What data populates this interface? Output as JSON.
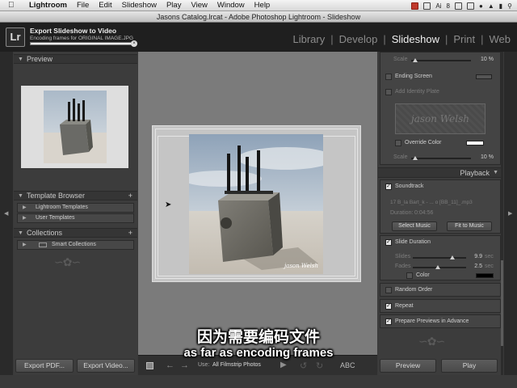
{
  "menubar": {
    "items": [
      "Lightroom",
      "File",
      "Edit",
      "Slideshow",
      "Play",
      "View",
      "Window",
      "Help"
    ],
    "tray": {
      "ai": "Ai",
      "ai_count": "8"
    }
  },
  "window": {
    "title": "Jasons Catalog.lrcat - Adobe Photoshop Lightroom - Slideshow"
  },
  "identity": {
    "logo": "Lr",
    "task_title": "Export Slideshow to Video",
    "task_detail": "Encoding frames for ORIGINAL IMAGE.JPG",
    "progress": 0.95
  },
  "modules": [
    "Library",
    "Develop",
    "Slideshow",
    "Print",
    "Web"
  ],
  "modules_sep": "|",
  "active_module": "Slideshow",
  "left_panel": {
    "preview_header": "Preview",
    "template_browser_header": "Template Browser",
    "templates": [
      "Lightroom Templates",
      "User Templates"
    ],
    "collections_header": "Collections",
    "collections": [
      "Smart Collections"
    ],
    "plus": "+",
    "export_pdf_button": "Export PDF...",
    "export_video_button": "Export Video..."
  },
  "toolbar": {
    "use_label": "Use:",
    "use_value": "All Filmstrip Photos",
    "abc": "ABC"
  },
  "right_panel": {
    "scale_label": "Scale",
    "scale_value": "10 %",
    "ending_screen": "Ending Screen",
    "add_identity_plate": "Add Identity Plate",
    "identity_plate_text": "jason Welsh",
    "override_color": "Override Color",
    "playback_header": "Playback",
    "soundtrack": "Soundtrack",
    "track_name": "17 B_la Bart_k - ... o [BB_11]_.mp3",
    "duration_label": "Duration:",
    "duration_value": "0:04:56",
    "select_music": "Select Music",
    "fit_to_music": "Fit to Music",
    "slide_duration": "Slide Duration",
    "slides_label": "Slides",
    "slides_value": "9.9",
    "slides_unit": "sec",
    "fades_label": "Fades",
    "fades_value": "2.5",
    "fades_unit": "sec",
    "color_label": "Color",
    "random_order": "Random Order",
    "repeat": "Repeat",
    "prepare_previews": "Prepare Previews in Advance",
    "preview_button": "Preview",
    "play_button": "Play",
    "checkmark": "✓"
  },
  "photo": {
    "signature": "jason Welsh"
  },
  "subtitles": {
    "chinese": "因为需要编码文件",
    "english": "as far as encoding frames"
  }
}
